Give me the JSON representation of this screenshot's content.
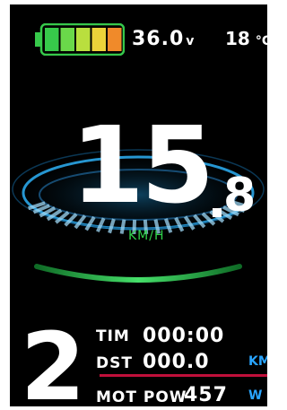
{
  "battery": {
    "segments": 5,
    "level": 1.0,
    "icon": "battery-icon",
    "colors": [
      "#37c94b",
      "#6ad84a",
      "#b9df3e",
      "#ecd23a",
      "#f08a2a"
    ]
  },
  "voltage": {
    "value": "36.0",
    "unit": "v"
  },
  "temperature": {
    "value": "18",
    "unit": "°C"
  },
  "speed": {
    "integer": "15",
    "decimal": "8",
    "unit": "KM/H"
  },
  "gear": "2",
  "stats": {
    "time": {
      "label": "TIM",
      "value": "000:00"
    },
    "distance": {
      "label": "DST",
      "value": "000.0",
      "unit": "KM"
    },
    "power": {
      "label": "MOT POW",
      "value": "457",
      "unit": "W"
    }
  },
  "colors": {
    "accent_blue": "#29a5ff",
    "accent_green": "#2fd14a",
    "divider": "#c0103a"
  }
}
